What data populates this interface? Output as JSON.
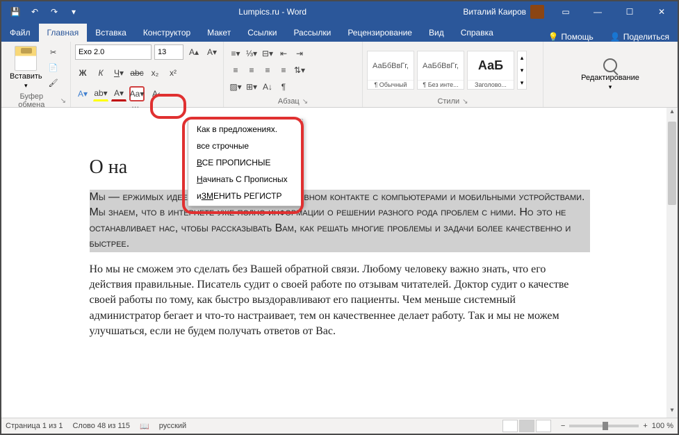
{
  "titlebar": {
    "title": "Lumpics.ru - Word",
    "user": "Виталий Каиров",
    "save_tip": "Сохранить",
    "undo_tip": "Отменить",
    "redo_tip": "Повторить",
    "minimize_tip": "Свернуть",
    "maximize_tip": "Развернуть",
    "close_tip": "Закрыть"
  },
  "tabs": {
    "file": "Файл",
    "home": "Главная",
    "insert": "Вставка",
    "design": "Конструктор",
    "layout": "Макет",
    "references": "Ссылки",
    "mailings": "Рассылки",
    "review": "Рецензирование",
    "view": "Вид",
    "help": "Справка",
    "tell_me": "Помощь",
    "share": "Поделиться"
  },
  "ribbon": {
    "paste": "Вставить",
    "clipboard": "Буфер обмена",
    "font_name": "Exo 2.0",
    "font_size": "13",
    "font_group": "Шриф",
    "para_group": "Абзац",
    "styles_group": "Стили",
    "style1_preview": "АаБбВвГг,",
    "style1_label": "¶ Обычный",
    "style2_preview": "АаБбВвГг,",
    "style2_label": "¶ Без инте...",
    "style3_preview": "АаБ",
    "style3_label": "Заголово...",
    "editing": "Редактирование"
  },
  "case_menu": {
    "sentence": "Как в предложениях.",
    "lower": "все строчные",
    "upper": "ВСЕ ПРОПИСНЫЕ",
    "cap_each": "Начинать С Прописных",
    "toggle": "иЗМЕНИТЬ РЕГИСТР"
  },
  "document": {
    "heading": "О на",
    "para1": "Мы —                                                ержимых идеей помогать Вам в ежедневном контакте с компьютерами и мобильными устройствами. Мы знаем, что в интернете уже полно информации о решении разного рода проблем с ними. Но это не останавливает нас, чтобы рассказывать Вам, как решать многие проблемы и задачи более качественно и быстрее.",
    "para2": "Но мы не сможем это сделать без Вашей обратной связи. Любому человеку важно знать, что его действия правильные. Писатель судит о своей работе по отзывам читателей. Доктор судит о качестве своей работы по тому, как быстро выздоравливают его пациенты. Чем меньше системный администратор бегает и что-то настраивает, тем он качественнее делает работу. Так и мы не можем улучшаться, если не будем получать ответов от Вас."
  },
  "statusbar": {
    "page": "Страница 1 из 1",
    "words": "Слово 48 из 115",
    "lang": "русский",
    "zoom": "100 %"
  }
}
